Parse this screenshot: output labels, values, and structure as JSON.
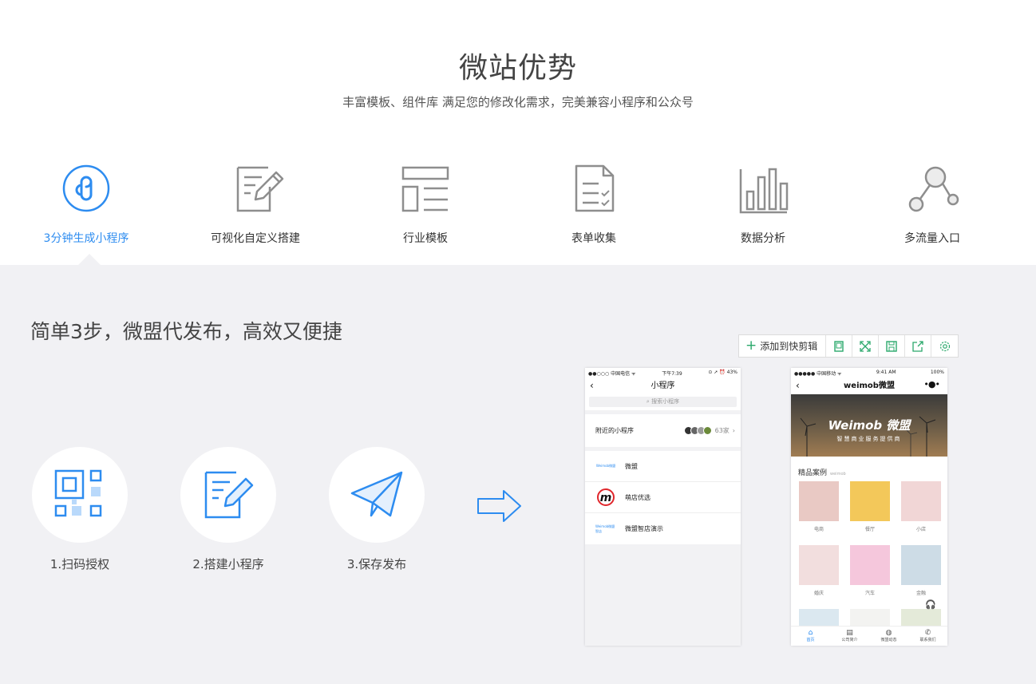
{
  "header": {
    "title": "微站优势",
    "subtitle": "丰富模板、组件库 满足您的修改化需求，完美兼容小程序和公众号"
  },
  "features": [
    {
      "label": "3分钟生成小程序",
      "icon": "mini-program-icon"
    },
    {
      "label": "可视化自定义搭建",
      "icon": "edit-document-icon"
    },
    {
      "label": "行业模板",
      "icon": "template-layout-icon"
    },
    {
      "label": "表单收集",
      "icon": "form-checklist-icon"
    },
    {
      "label": "数据分析",
      "icon": "bar-chart-icon"
    },
    {
      "label": "多流量入口",
      "icon": "share-nodes-icon"
    }
  ],
  "section": {
    "title": "简单3步，微盟代发布，高效又便捷"
  },
  "steps": [
    {
      "label": "1.扫码授权",
      "icon": "qr-code-icon"
    },
    {
      "label": "2.搭建小程序",
      "icon": "edit-document-icon"
    },
    {
      "label": "3.保存发布",
      "icon": "paper-plane-icon"
    }
  ],
  "toolbar": {
    "add_label": "添加到快剪辑"
  },
  "phone1": {
    "status_left": "●●○○○ 中国电信 ᯤ",
    "status_time": "下午7:39",
    "status_right": "⊙ ➚ ⏰ 43%",
    "nav_title": "小程序",
    "search_placeholder": "搜索小程序",
    "nearby_label": "附近的小程序",
    "nearby_count": "63家",
    "items": [
      {
        "name": "微盟",
        "logo_text": "Weimob微盟"
      },
      {
        "name": "萌店优选",
        "logo_text": "m"
      },
      {
        "name": "微盟智店演示",
        "logo_text": "Weimob微盟 智店"
      }
    ]
  },
  "phone2": {
    "status_left": "●●●●● 中国移动 ᯤ",
    "status_time": "9:41 AM",
    "status_right": "100%",
    "nav_title": "weimob微盟",
    "nav_more": "•●•",
    "banner_brand": "Weimob 微盟",
    "banner_slogan": "智慧商业服务提供商",
    "section_title": "精品案例",
    "section_en": "weimob",
    "cases": [
      {
        "label": "电商",
        "color": "#e9c9c4"
      },
      {
        "label": "餐厅",
        "color": "#f3c85a"
      },
      {
        "label": "小店",
        "color": "#f1d6d6"
      },
      {
        "label": "婚庆",
        "color": "#f2dede"
      },
      {
        "label": "汽车",
        "color": "#f5c7dc"
      },
      {
        "label": "金融",
        "color": "#cddce6"
      }
    ],
    "tabs": [
      "首页",
      "公司简介",
      "微盟动态",
      "联系我们"
    ]
  },
  "colors": {
    "accent": "#2d8cf0",
    "icon_gray": "#8e8e8e",
    "bg_light": "#f1f1f4"
  }
}
